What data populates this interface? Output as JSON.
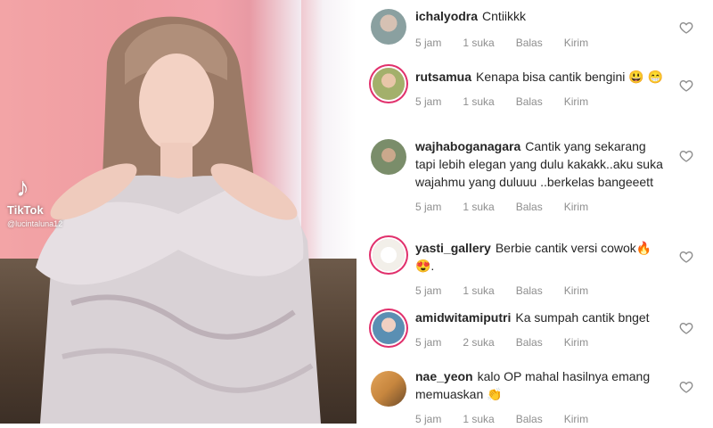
{
  "video": {
    "overlay_brand": "TikTok",
    "overlay_handle": "@lucintaluna12",
    "overlay_icon": "tiktok-note-icon"
  },
  "comments": [
    {
      "username": "ichalyodra",
      "text": "Cntiikkk",
      "time": "5 jam",
      "likes": "1 suka",
      "reply": "Balas",
      "send": "Kirim",
      "avatar_color": "#8aa0a0",
      "story_ring": false
    },
    {
      "username": "rutsamua",
      "text": "Kenapa bisa cantik bengini 😃 😁",
      "time": "5 jam",
      "likes": "1 suka",
      "reply": "Balas",
      "send": "Kirim",
      "avatar_color": "#a3b06b",
      "story_ring": true
    },
    {
      "username": "wajhaboganagara",
      "text": "Cantik yang sekarang tapi lebih elegan yang dulu kakakk..aku suka wajahmu yang duluuu ..berkelas bangeeett",
      "time": "5 jam",
      "likes": "1 suka",
      "reply": "Balas",
      "send": "Kirim",
      "avatar_color": "#7a8d6a",
      "story_ring": false
    },
    {
      "username": "yasti_gallery",
      "text": "Berbie cantik versi cowok🔥 😍.",
      "time": "5 jam",
      "likes": "1 suka",
      "reply": "Balas",
      "send": "Kirim",
      "avatar_color": "#f2efe9",
      "story_ring": true
    },
    {
      "username": "amidwitamiputri",
      "text": "Ka sumpah cantik bnget",
      "time": "5 jam",
      "likes": "2 suka",
      "reply": "Balas",
      "send": "Kirim",
      "avatar_color": "#5a8fb3",
      "story_ring": true
    },
    {
      "username": "nae_yeon",
      "text": "kalo OP mahal hasilnya emang memuaskan 👏",
      "time": "5 jam",
      "likes": "1 suka",
      "reply": "Balas",
      "send": "Kirim",
      "avatar_color": "#c7863e",
      "story_ring": false
    }
  ],
  "colors": {
    "story_ring": "#e1306c",
    "meta_text": "#8e8e8e",
    "body_text": "#262626"
  }
}
